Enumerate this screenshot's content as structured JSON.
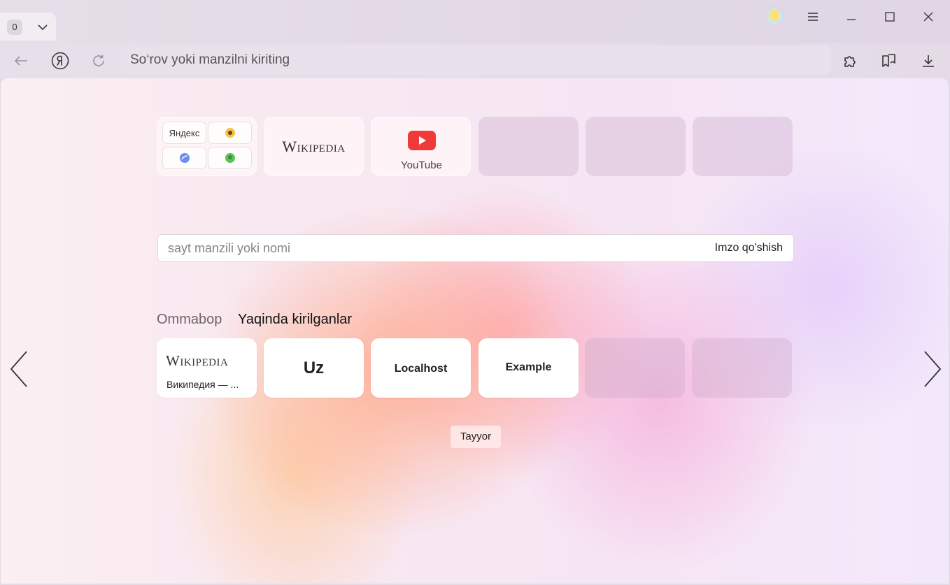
{
  "titlebar": {
    "tab_count": "0",
    "colors": {
      "bg": "#e3dbe6"
    }
  },
  "toolbar": {
    "omnibox_placeholder": "So‘rov yoki manzilni kiriting"
  },
  "icons": {
    "tab_chevron": "chevron-down-icon",
    "avatar": "avatar-icon",
    "menu": "hamburger-menu-icon",
    "minimize": "minimize-icon",
    "maximize": "maximize-icon",
    "close": "close-icon",
    "back": "back-arrow-icon",
    "yandex": "yandex-logo-icon",
    "reload": "reload-icon",
    "extensions": "puzzle-icon",
    "collections": "bookmarks-icon",
    "downloads": "download-icon"
  },
  "top_tiles": {
    "group": {
      "items": [
        "Яндекс",
        "zen-icon",
        "messenger-icon",
        "games-icon"
      ]
    },
    "wikipedia": "Wikipedia",
    "youtube": "YouTube"
  },
  "search": {
    "placeholder": "sayt manzili yoki nomi",
    "sign_label": "Imzo qo'shish"
  },
  "sections": {
    "tabs": [
      {
        "label": "Ommabop",
        "active": false
      },
      {
        "label": "Yaqinda kirilganlar",
        "active": true
      }
    ]
  },
  "recent_tiles": [
    {
      "logo": "Wikipedia",
      "caption": "Википедия — ..."
    },
    {
      "title": "Uz"
    },
    {
      "title": "Localhost"
    },
    {
      "title": "Example"
    }
  ],
  "done_label": "Tayyor"
}
